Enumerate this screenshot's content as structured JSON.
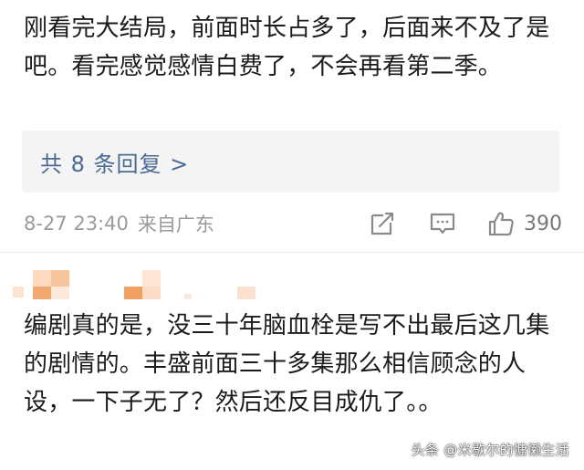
{
  "comment1": {
    "text": "刚看完大结局，前面时长占多了，后面来不及了是吧。看完感觉感情白费了，不会再看第二季。",
    "replies_label": "共 8 条回复 >",
    "timestamp": "8-27 23:40",
    "location": "来自广东",
    "like_count": "390",
    "icons": {
      "share": "share-icon",
      "reply": "comment-icon",
      "like": "thumbs-up-icon"
    }
  },
  "comment2": {
    "text": "编剧真的是，没三十年脑血栓是写不出最后这几集的剧情的。丰盛前面三十多集那么相信顾念的人设，一下子无了？然后还反目成仇了。。"
  },
  "watermark": "头条 @米歇尔的慵懒生活",
  "colors": {
    "link": "#4a6a94",
    "meta": "#9a9a9a",
    "reply_bg": "#f4f4f4",
    "mosaic_orange": "#f0a060"
  }
}
